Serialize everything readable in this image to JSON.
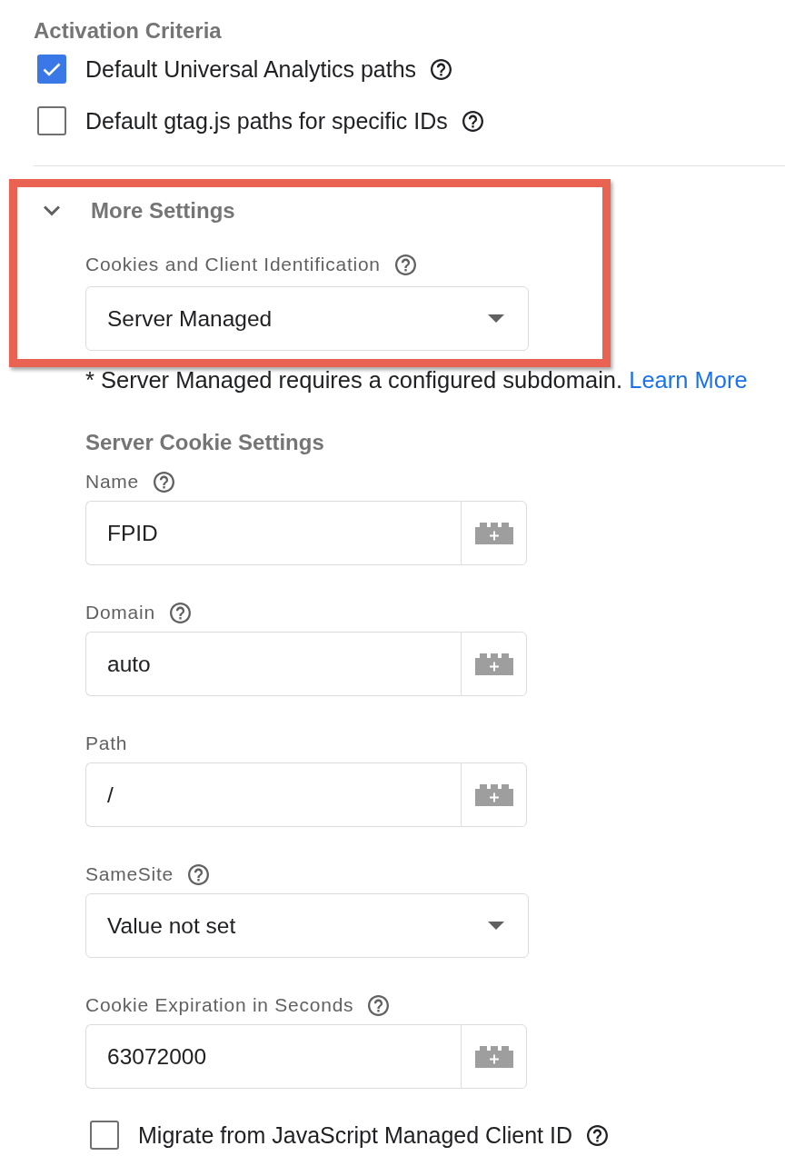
{
  "activation_criteria": {
    "title": "Activation Criteria",
    "options": [
      {
        "label": "Default Universal Analytics paths",
        "checked": true,
        "help": true
      },
      {
        "label": "Default gtag.js paths for specific IDs",
        "checked": false,
        "help": true
      }
    ]
  },
  "more_settings": {
    "title": "More Settings",
    "expanded": true,
    "highlighted": true,
    "client_identification": {
      "kind": "select",
      "label": "Cookies and Client Identification",
      "help": true,
      "value": "Server Managed"
    },
    "note": {
      "text": "* Server Managed requires a configured subdomain.",
      "link": "Learn More"
    },
    "server_cookie_settings": {
      "title": "Server Cookie Settings",
      "fields": [
        {
          "kind": "text",
          "label": "Name",
          "help": true,
          "value": "FPID"
        },
        {
          "kind": "text",
          "label": "Domain",
          "help": true,
          "value": "auto"
        },
        {
          "kind": "text",
          "label": "Path",
          "help": false,
          "value": "/"
        },
        {
          "kind": "select",
          "label": "SameSite",
          "help": true,
          "value": "Value not set"
        },
        {
          "kind": "text",
          "label": "Cookie Expiration in Seconds",
          "help": true,
          "value": "63072000"
        }
      ]
    },
    "migrate_option": {
      "label": "Migrate from JavaScript Managed Client ID",
      "checked": false,
      "help": true
    }
  }
}
